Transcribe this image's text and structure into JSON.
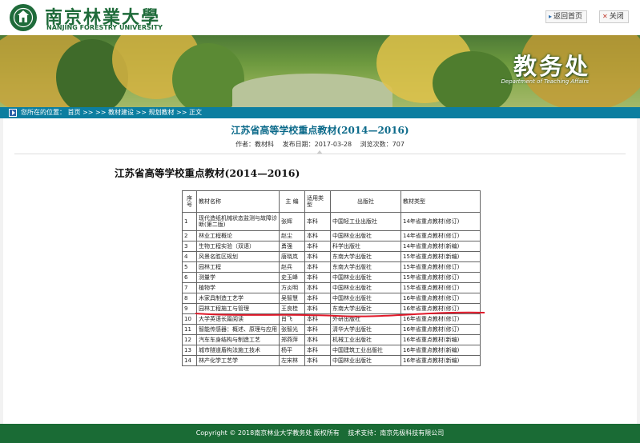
{
  "header": {
    "school_cn": "南京林業大學",
    "school_en": "NANJING FORESTRY UNIVERSITY",
    "home_label": "返回首页",
    "close_label": "关闭",
    "logo_icon": "university-emblem-icon",
    "brand_color": "#1f6b3a"
  },
  "banner": {
    "title": "教务处",
    "subtitle": "Department of Teaching Affairs"
  },
  "breadcrumb": {
    "prefix": "您所在的位置：",
    "home": "首页",
    "sep1": ">> >>",
    "section": "教材建设",
    "sep2": ">>",
    "category": "规划教材",
    "sep3": ">>",
    "current": "正文"
  },
  "article": {
    "title": "江苏省高等学校重点教材(2014—2016)",
    "author": "作者：教材科",
    "date": "发布日期：2017-03-28",
    "views": "浏览次数：707",
    "body_title": "江苏省高等学校重点教材(2014—2016)"
  },
  "table": {
    "headers": [
      "序号",
      "教材名称",
      "主  编",
      "适用类型",
      "出版社",
      "教材类型"
    ],
    "rows": [
      [
        "1",
        "现代造纸机械状态监测与故障诊断(第二版)",
        "张辉",
        "本科",
        "中国轻工业出版社",
        "14年省重点教材(修订)"
      ],
      [
        "2",
        "林业工程概论",
        "赵尘",
        "本科",
        "中国林业出版社",
        "14年省重点教材(修订)"
      ],
      [
        "3",
        "生物工程实验（双语）",
        "勇强",
        "本科",
        "科学出版社",
        "14年省重点教材(新编)"
      ],
      [
        "4",
        "风景名胜区规划",
        "唐晓岚",
        "本科",
        "东南大学出版社",
        "15年省重点教材(新编)"
      ],
      [
        "5",
        "园林工程",
        "赵兵",
        "本科",
        "东南大学出版社",
        "15年省重点教材(修订)"
      ],
      [
        "6",
        "测量学",
        "史玉峰",
        "本科",
        "中国林业出版社",
        "15年省重点教材(修订)"
      ],
      [
        "7",
        "植物学",
        "方炎明",
        "本科",
        "中国林业出版社",
        "15年省重点教材(修订)"
      ],
      [
        "8",
        "木家具制造工艺学",
        "吴智慧",
        "本科",
        "中国林业出版社",
        "16年省重点教材(修订)"
      ],
      [
        "9",
        "园林工程施工与管理",
        "王良桂",
        "本科",
        "东南大学出版社",
        "16年省重点教材(修订)"
      ],
      [
        "10",
        "大学英语长篇阅读",
        "肖飞",
        "本科",
        "外研出版社",
        "16年省重点教材(修订)"
      ],
      [
        "11",
        "智能传感器：概述、原理与应用",
        "张智光",
        "本科",
        "清华大学出版社",
        "16年省重点教材(修订)"
      ],
      [
        "12",
        "汽车车身结构与制造工艺",
        "郑燕萍",
        "本科",
        "机械工业出版社",
        "16年省重点教材(新编)"
      ],
      [
        "13",
        "城市隧道盾构法施工技术",
        "杨平",
        "本科",
        "中国建筑工业出版社",
        "16年省重点教材(新编)"
      ],
      [
        "14",
        "林产化学工艺学",
        "左宋林",
        "本科",
        "中国林业出版社",
        "16年省重点教材(新编)"
      ]
    ]
  },
  "footer": {
    "copyright": "Copyright © 2018南京林业大学教务处 版权所有",
    "support": "技术支持：南京先极科技有限公司"
  },
  "colors": {
    "breadcrumb_bg": "#0c7ea0",
    "footer_bg": "#1a6b35",
    "title_color": "#0c6a8a",
    "annotation_line": "#e0192a"
  }
}
